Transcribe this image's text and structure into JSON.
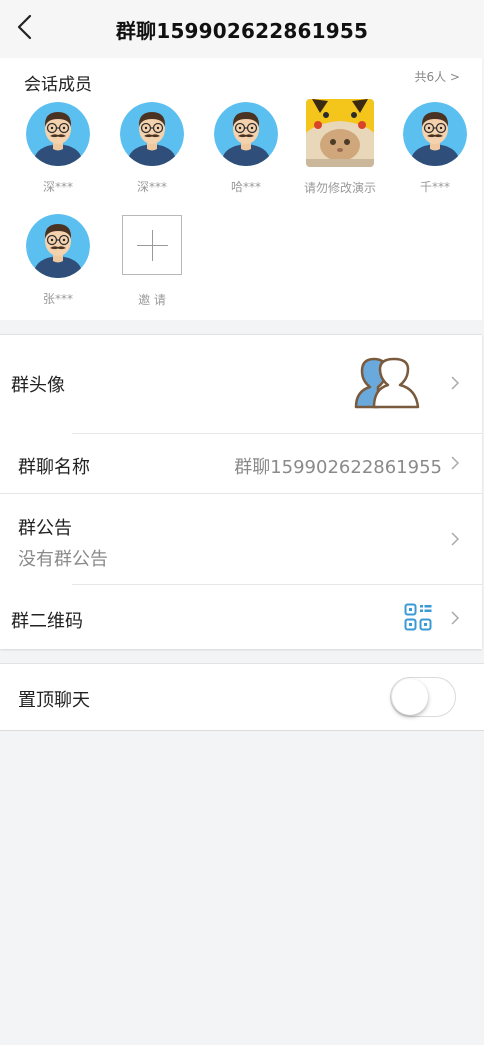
{
  "header": {
    "title": "群聊159902622861955"
  },
  "members": {
    "title": "会话成员",
    "count_label": "共6人 >",
    "items": [
      {
        "name": "深***",
        "avatar": "default-avatar"
      },
      {
        "name": "深***",
        "avatar": "default-avatar"
      },
      {
        "name": "哈***",
        "avatar": "default-avatar"
      },
      {
        "name": "请勿修改演示",
        "avatar": "pikachu-hat-cat-photo"
      },
      {
        "name": "千***",
        "avatar": "default-avatar"
      },
      {
        "name": "张***",
        "avatar": "default-avatar"
      }
    ],
    "invite_label": "邀 请"
  },
  "settings": {
    "group_avatar_label": "群头像",
    "group_name_label": "群聊名称",
    "group_name_value": "群聊159902622861955",
    "announcement_label": "群公告",
    "announcement_value": "没有群公告",
    "qrcode_label": "群二维码",
    "pin_chat_label": "置顶聊天",
    "pin_chat_enabled": false
  },
  "colors": {
    "accent_blue": "#5aaee6",
    "avatar_bg": "#5bc0f0",
    "page_bg": "#f3f4f6"
  }
}
